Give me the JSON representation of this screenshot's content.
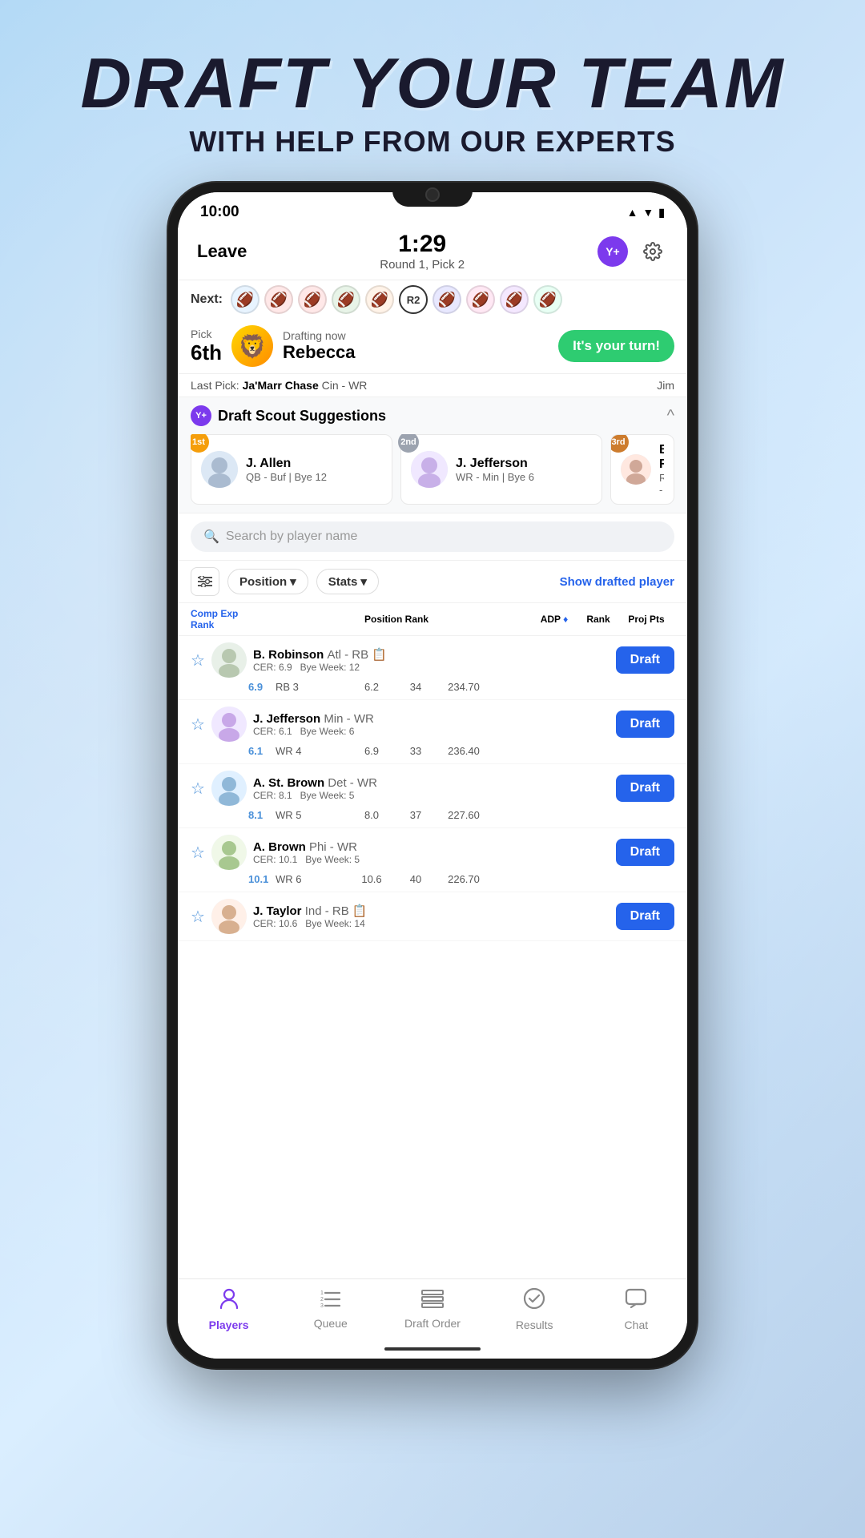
{
  "page": {
    "header_title": "DRAFT YOUR TEAM",
    "header_subtitle": "WITH HELP FROM OUR EXPERTS"
  },
  "status_bar": {
    "time": "10:00",
    "icons": "▲▼"
  },
  "top_nav": {
    "leave": "Leave",
    "timer": "1:29",
    "round_info": "Round 1, Pick 2",
    "yplus": "Y+",
    "gear": "⚙"
  },
  "helmet_row": {
    "next_label": "Next:",
    "r2": "R2",
    "helmets": [
      "🏈",
      "🏈",
      "🏈",
      "🏈",
      "🏈",
      "🏈",
      "🏈",
      "🏈",
      "🏈"
    ]
  },
  "draft_banner": {
    "pick_label": "Pick",
    "pick_num": "6th",
    "drafting_now": "Drafting now",
    "drafter": "Rebecca",
    "cta": "It's your turn!",
    "mascot": "🦁"
  },
  "last_pick": {
    "label": "Last Pick:",
    "player": "Ja'Marr Chase",
    "team_pos": "Cin - WR",
    "user": "Jim"
  },
  "scout": {
    "yplus": "Y+",
    "title": "Draft Scout Suggestions",
    "collapse": "^",
    "suggestions": [
      {
        "rank": "1st",
        "rank_class": "rank-1",
        "name": "J. Allen",
        "details": "QB - Buf | Bye 12",
        "emoji": "🏈"
      },
      {
        "rank": "2nd",
        "rank_class": "rank-2",
        "name": "J. Jefferson",
        "details": "WR - Min | Bye 6",
        "emoji": "🏈"
      },
      {
        "rank": "3rd",
        "rank_class": "rank-3",
        "name": "B. R...",
        "details": "RB -",
        "emoji": "🏈"
      }
    ]
  },
  "search": {
    "placeholder": "Search by player name"
  },
  "filters": {
    "position": "Position",
    "stats": "Stats",
    "show_drafted": "Show drafted player"
  },
  "table_header": {
    "comp_exp": "Comp Exp Rank",
    "position_rank": "Position Rank",
    "adp": "ADP",
    "rank": "Rank",
    "proj_pts": "Proj Pts"
  },
  "players": [
    {
      "name": "B. Robinson",
      "team_pos": "Atl - RB",
      "cer": "CER: 6.9",
      "bye": "Bye Week: 12",
      "cer_val": "6.9",
      "pos_rank": "RB 3",
      "adp": "6.2",
      "rank": "34",
      "proj": "234.70",
      "draft": "Draft"
    },
    {
      "name": "J. Jefferson",
      "team_pos": "Min - WR",
      "cer": "CER: 6.1",
      "bye": "Bye Week: 6",
      "cer_val": "6.1",
      "pos_rank": "WR 4",
      "adp": "6.9",
      "rank": "33",
      "proj": "236.40",
      "draft": "Draft"
    },
    {
      "name": "A. St. Brown",
      "team_pos": "Det - WR",
      "cer": "CER: 8.1",
      "bye": "Bye Week: 5",
      "cer_val": "8.1",
      "pos_rank": "WR 5",
      "adp": "8.0",
      "rank": "37",
      "proj": "227.60",
      "draft": "Draft"
    },
    {
      "name": "A. Brown",
      "team_pos": "Phi - WR",
      "cer": "CER: 10.1",
      "bye": "Bye Week: 5",
      "cer_val": "10.1",
      "pos_rank": "WR 6",
      "adp": "10.6",
      "rank": "40",
      "proj": "226.70",
      "draft": "Draft"
    },
    {
      "name": "J. Taylor",
      "team_pos": "Ind - RB",
      "cer": "CER: 10.6",
      "bye": "Bye Week: 14",
      "cer_val": "10.6",
      "pos_rank": "",
      "adp": "",
      "rank": "",
      "proj": "",
      "draft": "Draft"
    }
  ],
  "bottom_nav": {
    "players": "Players",
    "queue": "Queue",
    "draft_order": "Draft Order",
    "results": "Results",
    "chat": "Chat"
  }
}
